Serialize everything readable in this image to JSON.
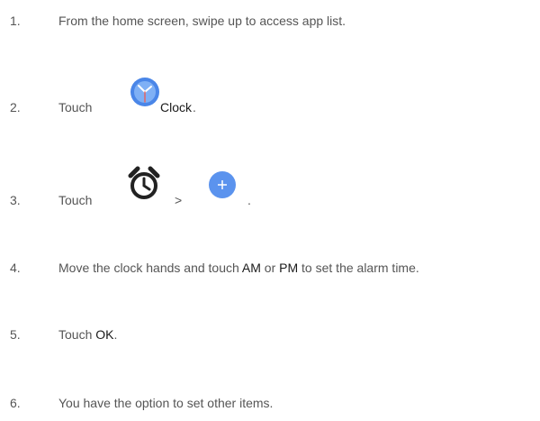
{
  "steps": [
    {
      "number": "1.",
      "text": "From the home screen, swipe up to access app list."
    },
    {
      "number": "2.",
      "text_before": "Touch",
      "icon": "clock-app-icon",
      "highlight": "Clock",
      "text_after": "."
    },
    {
      "number": "3.",
      "text_before": "Touch",
      "icon_1": "alarm-clock-icon",
      "separator": ">",
      "icon_2": "add-fab-icon",
      "text_after": "."
    },
    {
      "number": "4.",
      "text_before": "Move the clock hands and touch ",
      "highlight_1": "AM",
      "text_middle": " or ",
      "highlight_2": "PM",
      "text_after": " to set the alarm time."
    },
    {
      "number": "5.",
      "text_before": "Touch ",
      "highlight": "OK",
      "text_after": "."
    },
    {
      "number": "6.",
      "text": "You have the option to set other items."
    }
  ],
  "colors": {
    "body_text": "#555555",
    "highlight_text": "#1a1a1a",
    "icon_blue": "#4a86e8",
    "icon_blue_light": "#7fb0f5"
  }
}
